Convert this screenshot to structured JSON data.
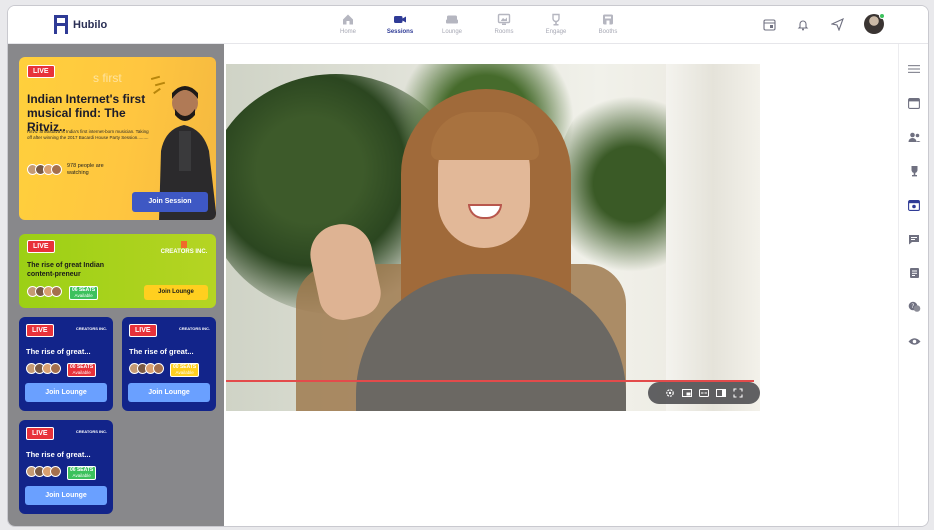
{
  "app": {
    "brand": "Hubilo"
  },
  "nav": [
    {
      "label": "Home",
      "icon": "home-icon",
      "active": false
    },
    {
      "label": "Sessions",
      "icon": "video-camera-icon",
      "active": true
    },
    {
      "label": "Lounge",
      "icon": "sofa-icon",
      "active": false
    },
    {
      "label": "Rooms",
      "icon": "monitor-icon",
      "active": false
    },
    {
      "label": "Engage",
      "icon": "trophy-icon",
      "active": false
    },
    {
      "label": "Booths",
      "icon": "store-icon",
      "active": false
    }
  ],
  "colors": {
    "primary": "#2f3b96",
    "live": "#e8323a",
    "hero": "#ffc640",
    "green_card": "#a9d11c",
    "blue_card": "#12248a",
    "progress": "#e34b4b"
  },
  "sessions": {
    "hero": {
      "live": "LIVE",
      "ghost": "s first",
      "title": "Indian Internet's first musical find: The Ritviz..",
      "desc": "Ritviz Srivastava is India's first internet-born musician. Taking off after winning the 2017 Bacardi House Party Session.........",
      "watching": "978 people are watching",
      "button": "Join Session"
    },
    "green": {
      "live": "LIVE",
      "brand": "CREATORS INC.",
      "title": "The rise of great Indian content-preneur",
      "seats_count": "06 SEATS",
      "seats_sub": "Available",
      "button": "Join Lounge"
    },
    "blue_cards": [
      {
        "live": "LIVE",
        "brand": "CREATORS INC.",
        "title": "The rise of great...",
        "seats_count": "00 SEATS",
        "seats_sub": "Available",
        "seats_color": "#e8323a",
        "button": "Join Lounge"
      },
      {
        "live": "LIVE",
        "brand": "CREATORS INC.",
        "title": "The rise of great...",
        "seats_count": "00 SEATS",
        "seats_sub": "Available",
        "seats_color": "#ffcf1f",
        "button": "Join Lounge"
      },
      {
        "live": "LIVE",
        "brand": "CREATORS INC.",
        "title": "The rise of great...",
        "seats_count": "06 SEATS",
        "seats_sub": "Available",
        "seats_color": "#3cc15d",
        "button": "Join Lounge"
      }
    ]
  }
}
